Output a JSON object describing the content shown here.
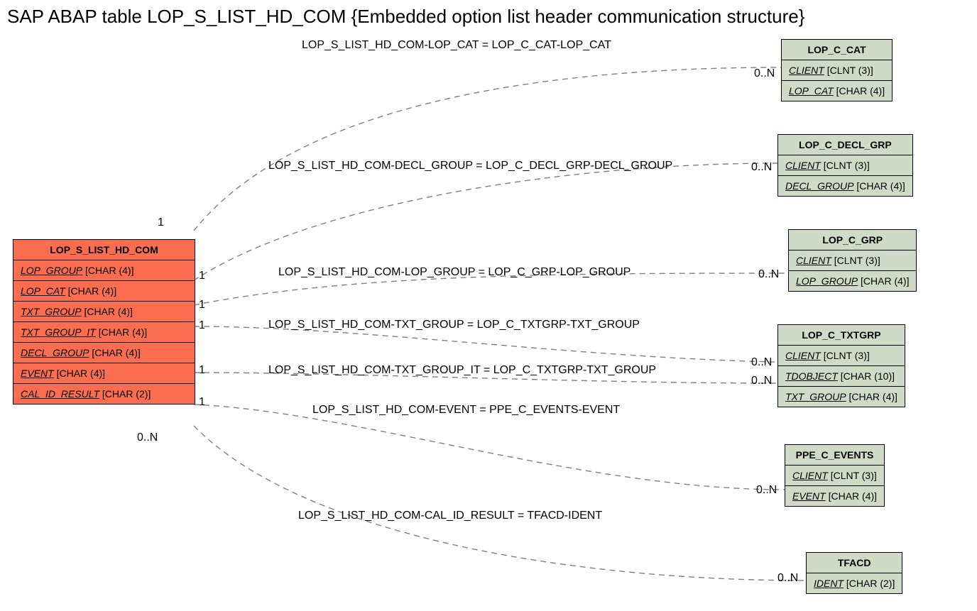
{
  "title": "SAP ABAP table LOP_S_LIST_HD_COM {Embedded option list header communication structure}",
  "main": {
    "name": "LOP_S_LIST_HD_COM",
    "fields": [
      {
        "name": "LOP_GROUP",
        "type": "[CHAR (4)]"
      },
      {
        "name": "LOP_CAT",
        "type": "[CHAR (4)]"
      },
      {
        "name": "TXT_GROUP",
        "type": "[CHAR (4)]"
      },
      {
        "name": "TXT_GROUP_IT",
        "type": "[CHAR (4)]"
      },
      {
        "name": "DECL_GROUP",
        "type": "[CHAR (4)]"
      },
      {
        "name": "EVENT",
        "type": "[CHAR (4)]"
      },
      {
        "name": "CAL_ID_RESULT",
        "type": "[CHAR (2)]"
      }
    ]
  },
  "targets": [
    {
      "name": "LOP_C_CAT",
      "fields": [
        {
          "name": "CLIENT",
          "type": "[CLNT (3)]"
        },
        {
          "name": "LOP_CAT",
          "type": "[CHAR (4)]"
        }
      ]
    },
    {
      "name": "LOP_C_DECL_GRP",
      "fields": [
        {
          "name": "CLIENT",
          "type": "[CLNT (3)]"
        },
        {
          "name": "DECL_GROUP",
          "type": "[CHAR (4)]"
        }
      ]
    },
    {
      "name": "LOP_C_GRP",
      "fields": [
        {
          "name": "CLIENT",
          "type": "[CLNT (3)]"
        },
        {
          "name": "LOP_GROUP",
          "type": "[CHAR (4)]"
        }
      ]
    },
    {
      "name": "LOP_C_TXTGRP",
      "fields": [
        {
          "name": "CLIENT",
          "type": "[CLNT (3)]"
        },
        {
          "name": "TDOBJECT",
          "type": "[CHAR (10)]"
        },
        {
          "name": "TXT_GROUP",
          "type": "[CHAR (4)]"
        }
      ]
    },
    {
      "name": "PPE_C_EVENTS",
      "fields": [
        {
          "name": "CLIENT",
          "type": "[CLNT (3)]"
        },
        {
          "name": "EVENT",
          "type": "[CHAR (4)]"
        }
      ]
    },
    {
      "name": "TFACD",
      "fields": [
        {
          "name": "IDENT",
          "type": "[CHAR (2)]"
        }
      ]
    }
  ],
  "relations": [
    {
      "label": "LOP_S_LIST_HD_COM-LOP_CAT = LOP_C_CAT-LOP_CAT"
    },
    {
      "label": "LOP_S_LIST_HD_COM-DECL_GROUP = LOP_C_DECL_GRP-DECL_GROUP"
    },
    {
      "label": "LOP_S_LIST_HD_COM-LOP_GROUP = LOP_C_GRP-LOP_GROUP"
    },
    {
      "label": "LOP_S_LIST_HD_COM-TXT_GROUP = LOP_C_TXTGRP-TXT_GROUP"
    },
    {
      "label": "LOP_S_LIST_HD_COM-TXT_GROUP_IT = LOP_C_TXTGRP-TXT_GROUP"
    },
    {
      "label": "LOP_S_LIST_HD_COM-EVENT = PPE_C_EVENTS-EVENT"
    },
    {
      "label": "LOP_S_LIST_HD_COM-CAL_ID_RESULT = TFACD-IDENT"
    }
  ],
  "card_one": "1",
  "card_many": "0..N"
}
